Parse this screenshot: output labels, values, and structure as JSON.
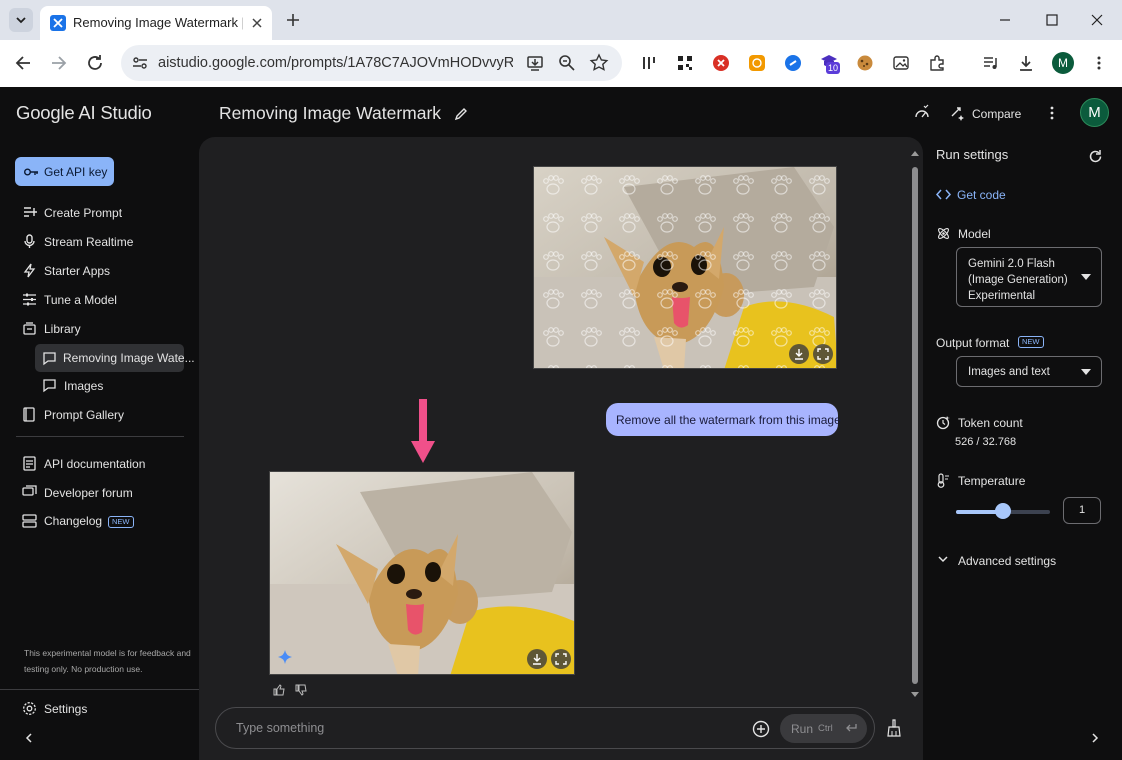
{
  "browser": {
    "tab_title": "Removing Image Watermark | G",
    "url": "aistudio.google.com/prompts/1A78C7AJOVmHODvvyR...",
    "profile_initial": "M",
    "extension_badge": "10"
  },
  "app": {
    "brand": "Google AI Studio",
    "page_title": "Removing Image Watermark",
    "compare_label": "Compare",
    "avatar_initial": "M"
  },
  "sidebar": {
    "get_api_key": "Get API key",
    "items": [
      {
        "label": "Create Prompt",
        "icon": "prompt-add-icon"
      },
      {
        "label": "Stream Realtime",
        "icon": "mic-icon"
      },
      {
        "label": "Starter Apps",
        "icon": "bolt-icon"
      },
      {
        "label": "Tune a Model",
        "icon": "tune-icon"
      },
      {
        "label": "Library",
        "icon": "library-icon"
      }
    ],
    "library_children": [
      {
        "label": "Removing Image Wate...",
        "icon": "chat-icon",
        "selected": true
      },
      {
        "label": "Images",
        "icon": "chat-icon"
      }
    ],
    "prompt_gallery": "Prompt Gallery",
    "links": [
      {
        "label": "API documentation",
        "icon": "doc-icon"
      },
      {
        "label": "Developer forum",
        "icon": "forum-icon"
      },
      {
        "label": "Changelog",
        "icon": "changelog-icon",
        "badge": "NEW"
      }
    ],
    "disclaimer": "This experimental model is for feedback and testing only. No production use.",
    "settings": "Settings"
  },
  "chat": {
    "user_message": "Remove all the watermark from this image",
    "input_placeholder": "Type something",
    "run_label": "Run",
    "run_shortcut": "Ctrl"
  },
  "run_settings": {
    "title": "Run settings",
    "get_code": "Get code",
    "model_label": "Model",
    "model_value_line1": "Gemini 2.0 Flash",
    "model_value_line2": "(Image Generation)",
    "model_value_line3": "Experimental",
    "output_format_label": "Output format",
    "output_format_badge": "NEW",
    "output_format_value": "Images and text",
    "token_count_label": "Token count",
    "token_count_value": "526 / 32.768",
    "temperature_label": "Temperature",
    "temperature_value": "1",
    "temperature_fraction": 0.5,
    "advanced_settings": "Advanced settings"
  },
  "colors": {
    "accent": "#8ab4f8",
    "user_bubble": "#a8b4ff",
    "arrow": "#f0508a"
  }
}
